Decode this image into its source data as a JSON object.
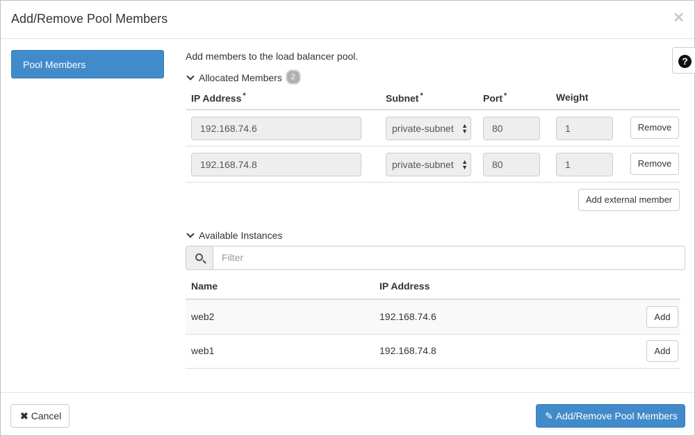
{
  "modal": {
    "title": "Add/Remove Pool Members",
    "close_glyph": "✕"
  },
  "sidebar": {
    "steps": [
      {
        "label": "Pool Members",
        "active": true
      }
    ]
  },
  "help": {
    "glyph": "?"
  },
  "main": {
    "intro": "Add members to the load balancer pool.",
    "allocated": {
      "title": "Allocated Members",
      "count": "2",
      "columns": {
        "ip": "IP Address",
        "subnet": "Subnet",
        "port": "Port",
        "weight": "Weight",
        "required_mark": "*"
      },
      "members": [
        {
          "ip": "192.168.74.6",
          "subnet": "private-subnet",
          "port": "80",
          "weight": "1",
          "remove_label": "Remove"
        },
        {
          "ip": "192.168.74.8",
          "subnet": "private-subnet",
          "port": "80",
          "weight": "1",
          "remove_label": "Remove"
        }
      ],
      "add_external_label": "Add external member"
    },
    "available": {
      "title": "Available Instances",
      "filter_placeholder": "Filter",
      "columns": {
        "name": "Name",
        "ip": "IP Address"
      },
      "instances": [
        {
          "name": "web2",
          "ip": "192.168.74.6",
          "add_label": "Add"
        },
        {
          "name": "web1",
          "ip": "192.168.74.8",
          "add_label": "Add"
        }
      ]
    }
  },
  "footer": {
    "cancel_label": "Cancel",
    "submit_label": "Add/Remove Pool Members"
  },
  "colors": {
    "primary": "#428bca",
    "border": "#cccccc",
    "readonly_bg": "#eeeeee"
  },
  "icons": {
    "close": "close-icon",
    "help": "question-circle-icon",
    "chevron": "chevron-down-icon",
    "search": "search-icon",
    "cancel": "times-icon",
    "pencil": "pencil-icon"
  }
}
